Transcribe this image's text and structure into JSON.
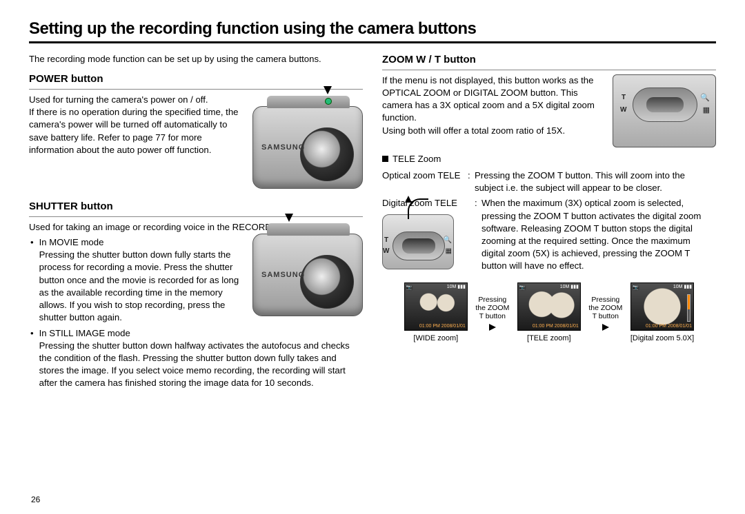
{
  "page_number": "26",
  "title": "Setting up the recording function using the camera buttons",
  "left": {
    "intro": "The recording mode function can be set up by using the camera buttons.",
    "power": {
      "heading": "POWER button",
      "line1": "Used for turning the camera's power on / off.",
      "para": "If there is no operation during the specified time, the camera's power will be turned off automatically to save battery life. Refer to page 77 for more information about the auto power off function."
    },
    "shutter": {
      "heading": "SHUTTER button",
      "line1": "Used for taking an image or recording voice in the RECORDING mode.",
      "movie_head": "In MOVIE mode",
      "movie_body": "Pressing the shutter button down fully starts the process for recording a movie. Press the shutter button once and the movie is recorded for as long as the available recording time in the memory allows. If you wish to stop recording, press the shutter button again.",
      "still_head": "In STILL IMAGE mode",
      "still_body": "Pressing the shutter button down halfway activates the autofocus and checks the condition of the flash. Pressing the shutter button down fully takes and stores the image. If you select voice memo recording, the recording will start after the camera has finished storing the image data for 10 seconds."
    },
    "camera_brand": "SAMSUNG"
  },
  "right": {
    "heading": "ZOOM W / T button",
    "para1": "If the menu is not displayed, this button works as the OPTICAL ZOOM or DIGITAL ZOOM button. This camera has a 3X optical zoom and a 5X digital zoom function.",
    "para2": "Using both will offer a total zoom ratio of 15X.",
    "tele_heading": "TELE Zoom",
    "optical_label": "Optical zoom TELE",
    "optical_body": "Pressing the ZOOM T button. This will zoom into the subject i.e. the subject will appear to be closer.",
    "digital_label": "Digital zoom TELE",
    "digital_body": "When the maximum (3X) optical zoom is selected, pressing the ZOOM T button activates the digital zoom software. Releasing ZOOM T button stops the digital zooming at the required setting. Once the maximum digital zoom (5X) is achieved, pressing the ZOOM T button will have no effect.",
    "pad": {
      "T": "T",
      "W": "W"
    },
    "press_label": "Pressing the ZOOM T button",
    "samples": {
      "wide": "[WIDE zoom]",
      "tele": "[TELE zoom]",
      "digi": "[Digital zoom 5.0X]",
      "hud_tl": "📷",
      "hud_tr": "10M\n▮▮▮",
      "hud_br": "01:00 PM\n2008/01/01"
    }
  }
}
